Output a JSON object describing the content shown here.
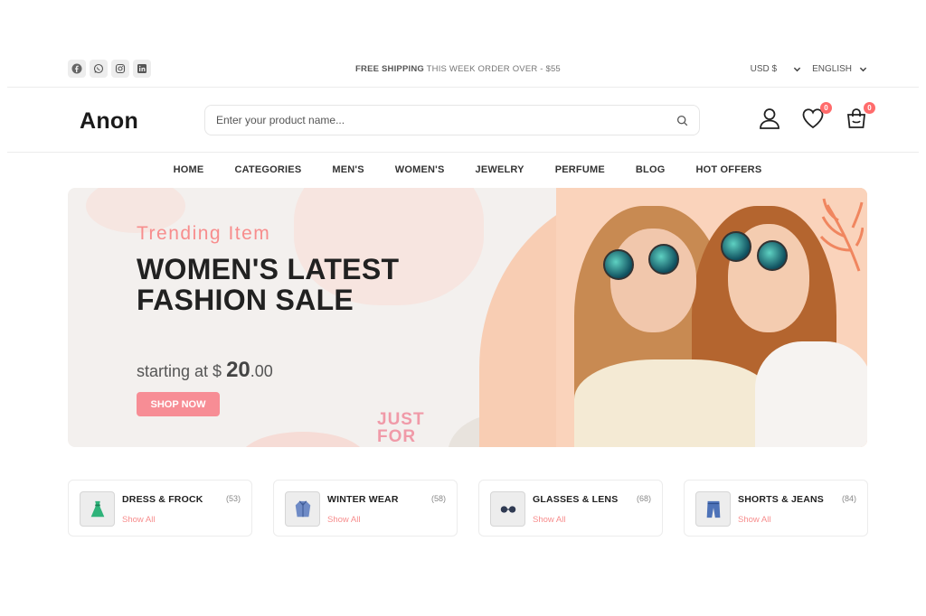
{
  "topbar": {
    "socials": [
      "facebook-icon",
      "whatsapp-icon",
      "instagram-icon",
      "linkedin-icon"
    ],
    "shipping_bold": "FREE SHIPPING",
    "shipping_rest": " THIS WEEK ORDER OVER - $55",
    "currency": "USD $",
    "language": "ENGLISH"
  },
  "header": {
    "logo": "Anon",
    "search_placeholder": "Enter your product name...",
    "wishlist_count": "0",
    "cart_count": "0"
  },
  "nav": {
    "items": [
      "HOME",
      "CATEGORIES",
      "MEN'S",
      "WOMEN'S",
      "JEWELRY",
      "PERFUME",
      "BLOG",
      "HOT OFFERS"
    ]
  },
  "banner": {
    "subtitle": "Trending Item",
    "title": "WOMEN'S LATEST FASHION SALE",
    "starting_prefix": "starting at $ ",
    "price_whole": "20",
    "price_cents": ".00",
    "button": "SHOP NOW",
    "badge_text_line1": "JUST",
    "badge_text_line2": "FOR"
  },
  "categories": [
    {
      "name": "DRESS & FROCK",
      "count": "(53)",
      "link": "Show All",
      "icon": "dress-icon"
    },
    {
      "name": "WINTER WEAR",
      "count": "(58)",
      "link": "Show All",
      "icon": "coat-icon"
    },
    {
      "name": "GLASSES & LENS",
      "count": "(68)",
      "link": "Show All",
      "icon": "glasses-icon"
    },
    {
      "name": "SHORTS & JEANS",
      "count": "(84)",
      "link": "Show All",
      "icon": "jeans-icon"
    }
  ],
  "colors": {
    "accent": "#f78d8d",
    "banner_bg": "#f3f0ee",
    "button": "#f78d95"
  }
}
